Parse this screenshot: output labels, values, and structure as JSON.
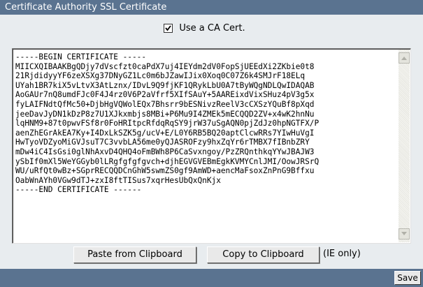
{
  "window": {
    "title": "Certificate Authority SSL Certificate"
  },
  "ca_option": {
    "label": "Use a CA Cert.",
    "checked": true
  },
  "certificate": {
    "text": "-----BEGIN CERTIFICATE -----\nMIICXQIBAAKBgQDjy7dVscfzt0caPdX7uj4IEYdm2dV0FopSjUEEdXi2ZKbie0t8\n21RjdidyyYF6zeXSXg37DNyGZ1Lc0m6bJZawIJix0Xoq0C07Z6k4SMJrF18ELq\nUYah1BR7kiX5vLtvX3AtLznx/IDvL9Q9fjKF1QRykLbU0A7tByWQgNDLQwIDAQAB\nAoGAUr7nQ8umdFJc0F4J4rz0V6P2aVfrf5XIfSAuY+5AAREixdVixSHuz4pV3g5x\nfyLAIFNdtQfMc50+DjbHgVQWolEQx7Bhsrr9bESNivzReelV3cCXSzYQuBf8pXqd\njeeDavJyDN1kDzP8z7U1XJkxmbjs8MBi+P6Mu9I4ZMEk5mECQQD2ZV+x4wK2hnNu\nlqHNM9+87t0pwvFSf8r0FoHRItpcRfdqRqSY9jrW37uSgAQN0pjZdJz0hpNGTFX/P\naenZhEGrAkEA7Ky+I4DxLkSZK5g/ucV+E/L0Y6RB5BQ20aptClcwRRs7YIwHuVgI\nHwTyoVDZyoMiGVJsuT7C3vvbLA56me0yQJASROFzy9hxZqYr6rTMBX7fIBnbZRY\nmDw4iC4IsGsi0glNhAxvD4QHQ4oFmBWh8P6CaSvxngoy/PzZRQnthkqYYwJBAJW3\nySbIf0mXl5WeYGGyb0lLRgfgfgfgvch+djhEGVGVEBmEgkKVMYCnlJMI/OowJRSrQ\nWU/uRfQt0wBz+SGprRECQQDCnGhW5swmZS0gf9AmWD+aencMaFsoxZnPnG9Bffxu\nOabWnAYh0VGw9dTJ+zxI8ftTISus7xqrHesUbQxQnKjx\n-----END CERTIFICATE ------"
  },
  "buttons": {
    "paste": "Paste from Clipboard",
    "copy": "Copy to Clipboard",
    "ie_note": "(IE only)",
    "save": "Save"
  },
  "colors": {
    "title_bar": "#5a7390",
    "panel_bg": "#e8ecef"
  },
  "icons": {
    "checkbox": "checkmark-icon",
    "scroll_up": "triangle-up-icon",
    "scroll_down": "triangle-down-icon"
  }
}
